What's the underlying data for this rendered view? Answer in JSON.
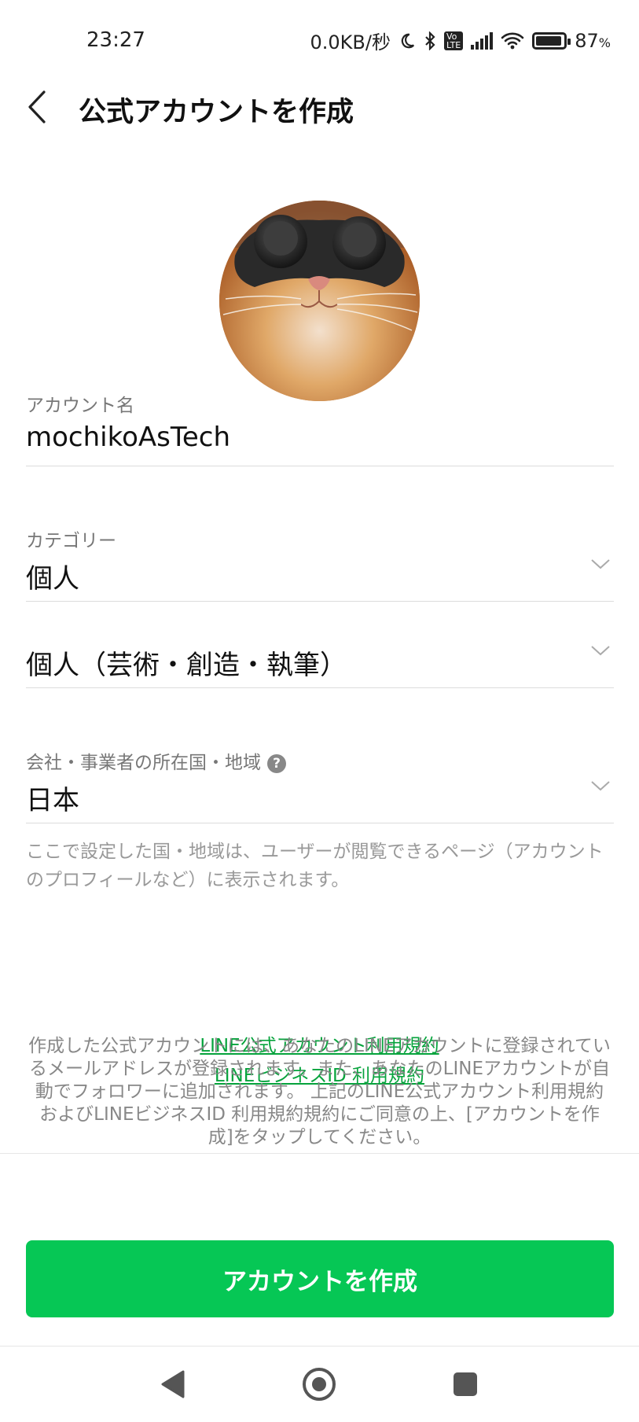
{
  "status_bar": {
    "time": "23:27",
    "network_speed": "0.0KB/秒",
    "battery": "87",
    "battery_unit": "%",
    "volte": "VoLTE"
  },
  "header": {
    "title": "公式アカウントを作成"
  },
  "form": {
    "account_name_label": "アカウント名",
    "account_name_value": "mochikoAsTech",
    "category_label": "カテゴリー",
    "category_value": "個人",
    "subcategory_value": "個人（芸術・創造・執筆）",
    "country_label": "会社・事業者の所在国・地域",
    "country_help": "?",
    "country_value": "日本",
    "country_note": "ここで設定した国・地域は、ユーザーが閲覧できるページ（アカウントのプロフィールなど）に表示されます。"
  },
  "links": {
    "terms_official": "LINE公式アカウント利用規約",
    "terms_business": "LINEビジネスID 利用規約"
  },
  "terms_text": "作成した公式アカウントには、あなたのLINEアカウントに登録されているメールアドレスが登録されます。また、あなたのLINEアカウントが自動でフォロワーに追加されます。 上記のLINE公式アカウント利用規約およびLINEビジネスID 利用規約規約にご同意の上、[アカウントを作成]をタップしてください。",
  "create_button": "アカウントを作成",
  "colors": {
    "accent": "#06c755",
    "link": "#06a33c"
  }
}
